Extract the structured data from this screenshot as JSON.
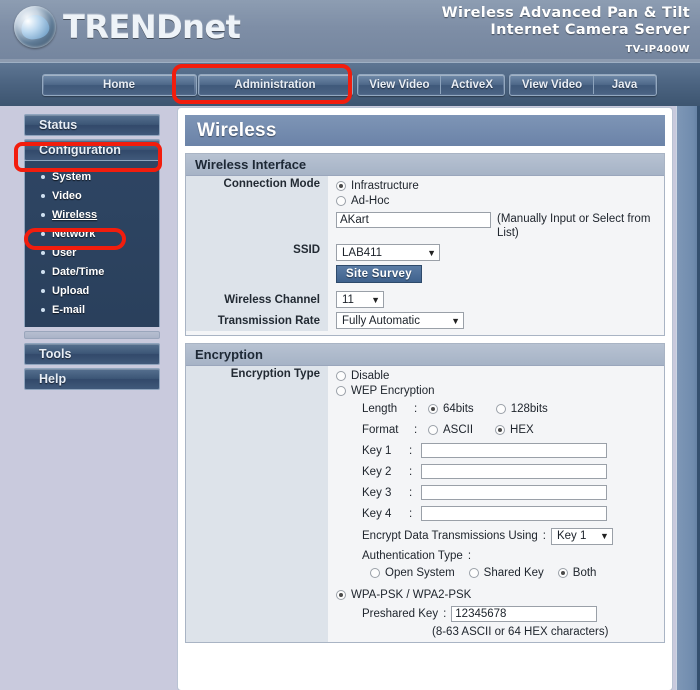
{
  "header": {
    "brand_trend": "TREND",
    "brand_net": "net",
    "logo_icon": "trendnet-globe-logo",
    "product_line1": "Wireless Advanced Pan & Tilt",
    "product_line2": "Internet Camera Server",
    "model": "TV-IP400W"
  },
  "tabs": [
    {
      "label": "Home",
      "name": "tab-home"
    },
    {
      "label": "Administration",
      "name": "tab-administration"
    },
    {
      "label": "View Video",
      "name": "tab-view-video-activex"
    },
    {
      "label": "ActiveX",
      "name": "tab-activex"
    },
    {
      "label": "View Video",
      "name": "tab-view-video-java"
    },
    {
      "label": "Java",
      "name": "tab-java"
    }
  ],
  "sidebar": {
    "status_label": "Status",
    "configuration_label": "Configuration",
    "tools_label": "Tools",
    "help_label": "Help",
    "sub_items": [
      {
        "label": "System"
      },
      {
        "label": "Video"
      },
      {
        "label": "Wireless"
      },
      {
        "label": "Network"
      },
      {
        "label": "User"
      },
      {
        "label": "Date/Time"
      },
      {
        "label": "Upload"
      },
      {
        "label": "E-mail"
      }
    ]
  },
  "page": {
    "title": "Wireless"
  },
  "wireless_interface": {
    "section_title": "Wireless Interface",
    "connection_mode_label": "Connection Mode",
    "connection_modes": [
      {
        "label": "Infrastructure",
        "selected": true
      },
      {
        "label": "Ad-Hoc",
        "selected": false
      }
    ],
    "ssid_label": "SSID",
    "ssid_value": "AKart",
    "ssid_hint": "(Manually Input or Select from List)",
    "ssid_select_value": "LAB411",
    "site_survey_label": "Site Survey",
    "wireless_channel_label": "Wireless Channel",
    "wireless_channel_value": "11",
    "transmission_rate_label": "Transmission Rate",
    "transmission_rate_value": "Fully Automatic"
  },
  "encryption": {
    "section_title": "Encryption",
    "type_label": "Encryption Type",
    "disable_label": "Disable",
    "disable_selected": false,
    "wep_label": "WEP Encryption",
    "wep_selected": false,
    "length_label": "Length",
    "length_options": [
      {
        "label": "64bits",
        "selected": true
      },
      {
        "label": "128bits",
        "selected": false
      }
    ],
    "format_label": "Format",
    "format_options": [
      {
        "label": "ASCII",
        "selected": false
      },
      {
        "label": "HEX",
        "selected": true
      }
    ],
    "keys": [
      {
        "label": "Key 1",
        "value": ""
      },
      {
        "label": "Key 2",
        "value": ""
      },
      {
        "label": "Key 3",
        "value": ""
      },
      {
        "label": "Key 4",
        "value": ""
      }
    ],
    "encrypt_using_label": "Encrypt Data Transmissions Using",
    "encrypt_using_value": "Key 1",
    "auth_type_label": "Authentication Type",
    "auth_options": [
      {
        "label": "Open System",
        "selected": false
      },
      {
        "label": "Shared Key",
        "selected": false
      },
      {
        "label": "Both",
        "selected": true
      }
    ],
    "wpa_label": "WPA-PSK / WPA2-PSK",
    "wpa_selected": true,
    "preshared_key_label": "Preshared Key",
    "preshared_key_value": "12345678",
    "preshared_key_hint": "(8-63 ASCII or 64 HEX characters)",
    "colon": ":"
  },
  "annotations": {
    "highlight_color": "#f21d0d",
    "boxes": [
      "administration-tab",
      "configuration-nav",
      "network-subnav"
    ]
  }
}
